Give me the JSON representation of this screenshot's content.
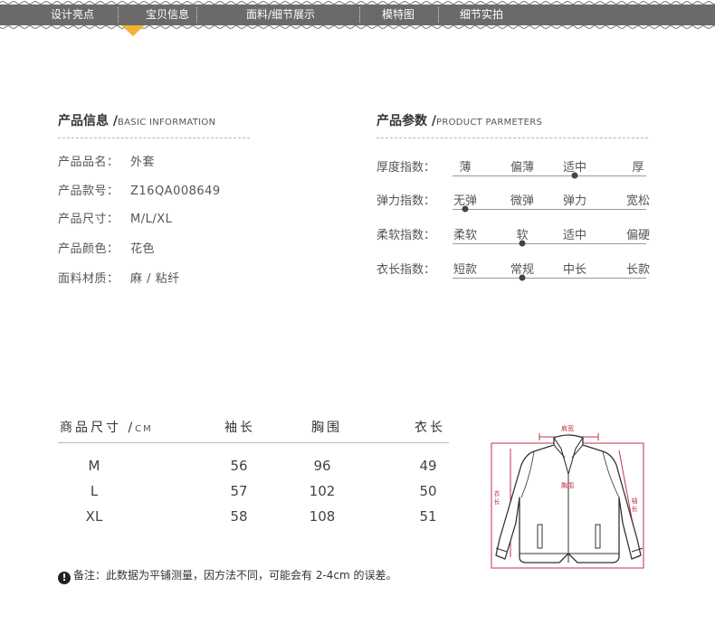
{
  "nav": {
    "items": [
      {
        "label": "设计亮点"
      },
      {
        "label": "宝贝信息"
      },
      {
        "label": "面料/细节展示"
      },
      {
        "label": "模特图"
      },
      {
        "label": "细节实拍"
      }
    ],
    "active_index": 1,
    "bar_color": "#6a6a6a",
    "marker_color": "#f3b237"
  },
  "product_info": {
    "title": "产品信息 /",
    "title_en": "BASIC INFORMATION",
    "rows": [
      {
        "label": "产品品名：",
        "value": "外套"
      },
      {
        "label": "产品款号：",
        "value": "Z16QA008649"
      },
      {
        "label": "产品尺寸：",
        "value": "M/L/XL"
      },
      {
        "label": "产品颜色：",
        "value": "花色"
      },
      {
        "label": "面料材质：",
        "value": "麻 / 粘纤"
      }
    ]
  },
  "product_params": {
    "title": "产品参数 /",
    "title_en": "PRODUCT PARMETERS",
    "rows": [
      {
        "label": "厚度指数：",
        "options": [
          "薄",
          "偏薄",
          "适中",
          "厚"
        ],
        "selected_index": 2
      },
      {
        "label": "弹力指数：",
        "options": [
          "无弹",
          "微弹",
          "弹力",
          "宽松"
        ],
        "selected_index": 0
      },
      {
        "label": "柔软指数：",
        "options": [
          "柔软",
          "软",
          "适中",
          "偏硬"
        ],
        "selected_index": 1
      },
      {
        "label": "衣长指数：",
        "options": [
          "短款",
          "常规",
          "中长",
          "长款"
        ],
        "selected_index": 1
      }
    ]
  },
  "size_table": {
    "title": "商品尺寸 /",
    "unit": "CM",
    "columns": [
      "袖长",
      "胸围",
      "衣长"
    ],
    "rows": [
      {
        "size": "M",
        "values": [
          "56",
          "96",
          "49"
        ]
      },
      {
        "size": "L",
        "values": [
          "57",
          "102",
          "50"
        ]
      },
      {
        "size": "XL",
        "values": [
          "58",
          "108",
          "51"
        ]
      }
    ]
  },
  "note": {
    "icon": "exclamation-icon",
    "text": "备注：此数据为平铺测量，因方法不同，可能会有 2-4cm 的误差。"
  },
  "diagram": {
    "labels": {
      "shoulder": "肩宽",
      "chest": "胸围",
      "length": "衣长",
      "sleeve": "袖长"
    },
    "measure_color": "#c0314a",
    "icon": "jacket-outline-icon"
  }
}
